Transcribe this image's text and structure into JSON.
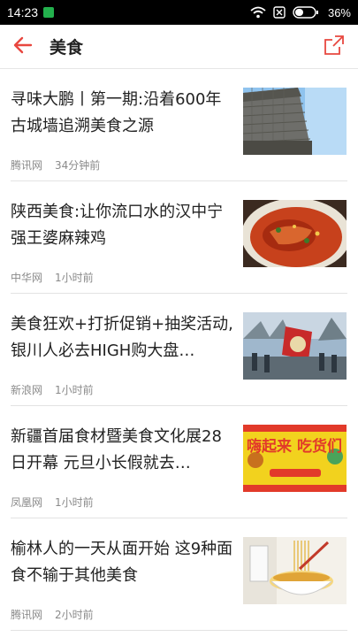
{
  "status_bar": {
    "time": "14:23",
    "battery": "36%",
    "icons": [
      "notification-app-icon",
      "wifi-icon",
      "sim-icon",
      "battery-icon"
    ]
  },
  "header": {
    "title": "美食",
    "back_icon": "back-arrow-icon",
    "share_icon": "share-icon",
    "accent_color": "#e8473f"
  },
  "articles": [
    {
      "title": "寻味大鹏丨第一期:沿着600年古城墙追溯美食之源",
      "source": "腾讯网",
      "time": "34分钟前",
      "thumbnail": "ancient-city-wall-photo"
    },
    {
      "title": "陕西美食:让你流口水的汉中宁强王婆麻辣鸡",
      "source": "中华网",
      "time": "1小时前",
      "thumbnail": "spicy-chicken-dish-photo"
    },
    {
      "title": "美食狂欢+打折促销+抽奖活动,银川人必去HIGH购大盘…",
      "source": "新浪网",
      "time": "1小时前",
      "thumbnail": "outdoor-event-stage-photo"
    },
    {
      "title": "新疆首届食材暨美食文化展28日开幕 元旦小长假就去…",
      "source": "凤凰网",
      "time": "1小时前",
      "thumbnail": "foodie-festival-poster",
      "thumbnail_text": "嗨起来 吃货们"
    },
    {
      "title": "榆林人的一天从面开始 这9种面食不输于其他美食",
      "source": "腾讯网",
      "time": "2小时前",
      "thumbnail": "noodles-bowl-photo"
    }
  ]
}
